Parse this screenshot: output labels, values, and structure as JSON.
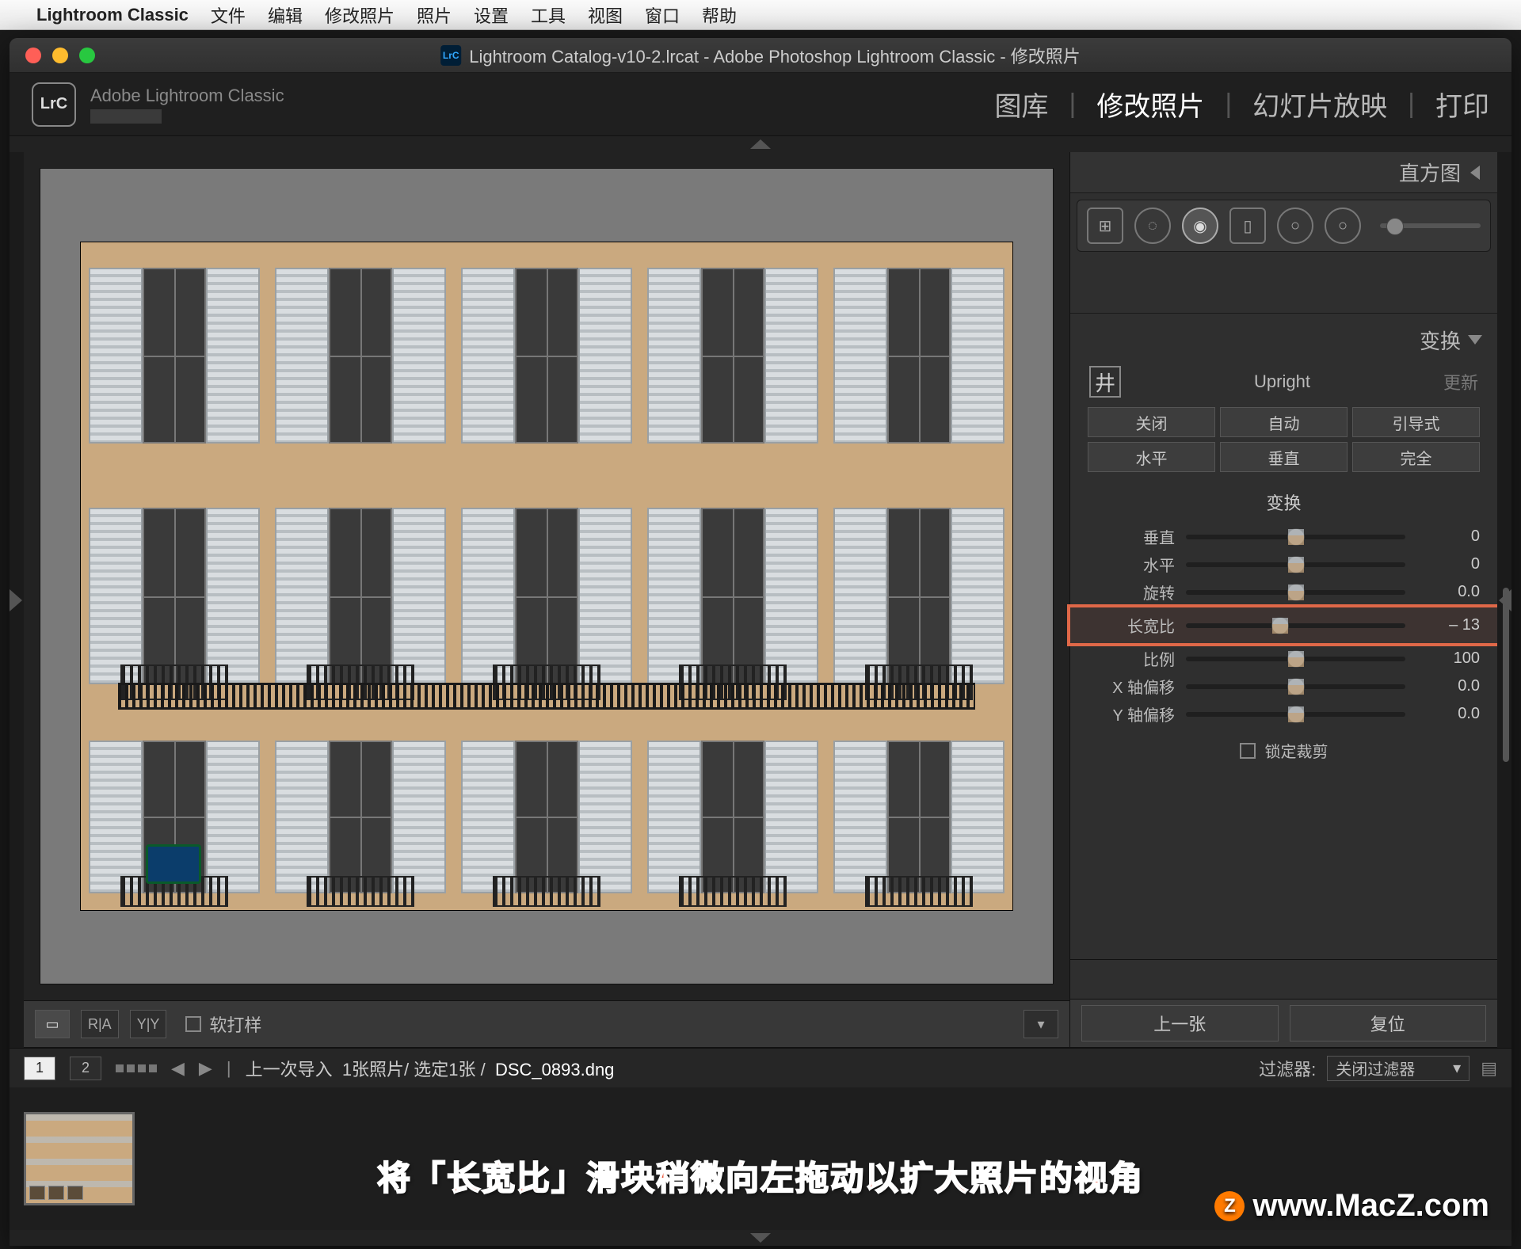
{
  "mac_menu": {
    "app_name": "Lightroom Classic",
    "items": [
      "文件",
      "编辑",
      "修改照片",
      "照片",
      "设置",
      "工具",
      "视图",
      "窗口",
      "帮助"
    ]
  },
  "titlebar": {
    "doc_title": "Lightroom Catalog-v10-2.lrcat - Adobe Photoshop Lightroom Classic - 修改照片",
    "badge": "LrC"
  },
  "header": {
    "logo_text": "LrC",
    "subtitle": "Adobe Lightroom Classic",
    "modules": [
      "图库",
      "修改照片",
      "幻灯片放映",
      "打印"
    ],
    "active_module": "修改照片"
  },
  "right_panel": {
    "histogram_label": "直方图",
    "transform_label": "变换",
    "upright": {
      "label": "Upright",
      "update": "更新",
      "buttons_row1": [
        "关闭",
        "自动",
        "引导式"
      ],
      "buttons_row2": [
        "水平",
        "垂直",
        "完全"
      ]
    },
    "transform_section_title": "变换",
    "sliders": [
      {
        "label": "垂直",
        "value": "0",
        "pos": 50
      },
      {
        "label": "水平",
        "value": "0",
        "pos": 50
      },
      {
        "label": "旋转",
        "value": "0.0",
        "pos": 50
      },
      {
        "label": "长宽比",
        "value": "– 13",
        "pos": 43,
        "highlight": true
      },
      {
        "label": "比例",
        "value": "100",
        "pos": 50
      },
      {
        "label": "X 轴偏移",
        "value": "0.0",
        "pos": 50
      },
      {
        "label": "Y 轴偏移",
        "value": "0.0",
        "pos": 50
      }
    ],
    "lock_crop": "锁定裁剪",
    "prev_btn": "上一张",
    "reset_btn": "复位"
  },
  "under_bar": {
    "soft_proof": "软打样",
    "view_modes": [
      "▭",
      "R|A",
      "Y|Y"
    ]
  },
  "film_head": {
    "nums": [
      "1",
      "2"
    ],
    "breadcrumb_prefix": "上一次导入",
    "count_text": "1张照片/ 选定1张 /",
    "filename": "DSC_0893.dng",
    "filter_label": "过滤器:",
    "filter_value": "关闭过滤器"
  },
  "caption_overlay": "将「长宽比」滑块稍微向左拖动以扩大照片的视角",
  "watermark": "www.MacZ.com"
}
